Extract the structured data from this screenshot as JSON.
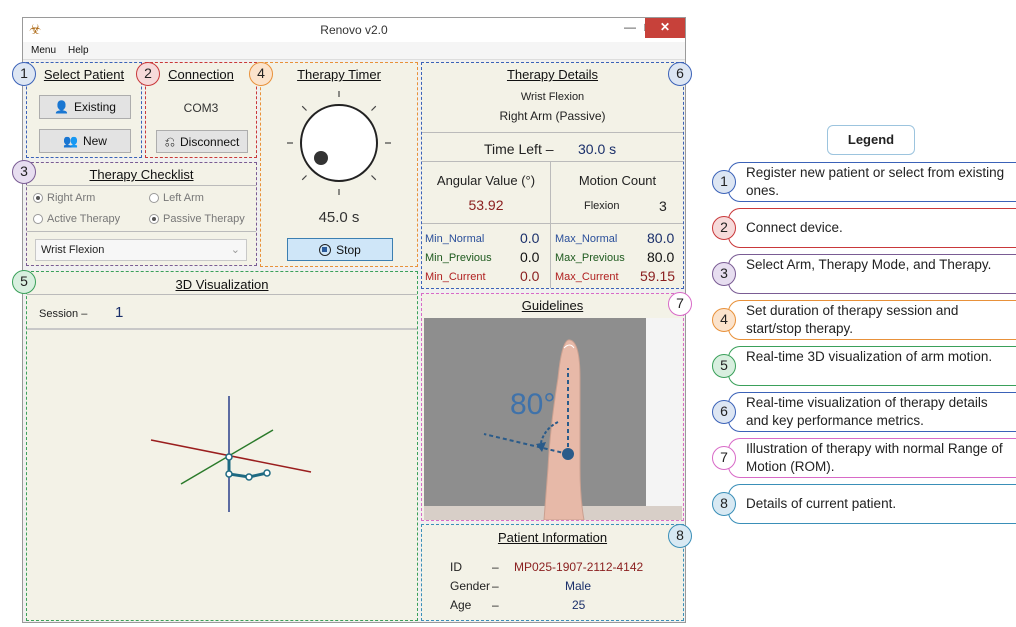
{
  "window": {
    "title": "Renovo v2.0",
    "minimize": "—",
    "maximize": "□",
    "close": "✕",
    "app_icon": "caduceus-icon"
  },
  "menu": {
    "items": [
      "Menu",
      "Help"
    ]
  },
  "select_patient": {
    "title": "Select Patient",
    "existing_label": "Existing",
    "new_label": "New"
  },
  "connection": {
    "title": "Connection",
    "port": "COM3",
    "disconnect_label": "Disconnect"
  },
  "therapy_timer": {
    "title": "Therapy Timer",
    "time": "45.0 s",
    "stop_label": "Stop"
  },
  "therapy_details": {
    "title": "Therapy Details",
    "therapy": "Wrist Flexion",
    "arm_mode": "Right Arm (Passive)",
    "time_left_label": "Time Left –",
    "time_left_value": "30.0 s",
    "angular_header": "Angular Value (°)",
    "angular_value": "53.92",
    "motion_header": "Motion Count",
    "motion_label": "Flexion",
    "motion_value": "3",
    "min_normal_label": "Min_Normal",
    "min_normal_value": "0.0",
    "min_previous_label": "Min_Previous",
    "min_previous_value": "0.0",
    "min_current_label": "Min_Current",
    "min_current_value": "0.0",
    "max_normal_label": "Max_Normal",
    "max_normal_value": "80.0",
    "max_previous_label": "Max_Previous",
    "max_previous_value": "80.0",
    "max_current_label": "Max_Current",
    "max_current_value": "59.15"
  },
  "checklist": {
    "title": "Therapy Checklist",
    "right_arm": "Right Arm",
    "left_arm": "Left Arm",
    "active": "Active Therapy",
    "passive": "Passive Therapy",
    "selected_therapy": "Wrist Flexion"
  },
  "visualization": {
    "title": "3D Visualization",
    "session_label": "Session –",
    "session_value": "1"
  },
  "guidelines": {
    "title": "Guidelines",
    "angle_label": "80°"
  },
  "patient_info": {
    "title": "Patient Information",
    "id_label": "ID",
    "id_dash": "–",
    "id_value": "MP025-1907-2112-4142",
    "gender_label": "Gender",
    "gender_dash": "–",
    "gender_value": "Male",
    "age_label": "Age",
    "age_dash": "–",
    "age_value": "25"
  },
  "badges": [
    "1",
    "2",
    "3",
    "4",
    "5",
    "6",
    "7",
    "8"
  ],
  "legend": {
    "title": "Legend",
    "items": [
      {
        "num": "1",
        "text": "Register new patient or select from existing ones."
      },
      {
        "num": "2",
        "text": "Connect device."
      },
      {
        "num": "3",
        "text": "Select Arm, Therapy Mode, and Therapy."
      },
      {
        "num": "4",
        "text": "Set duration of therapy session and start/stop therapy."
      },
      {
        "num": "5",
        "text": "Real-time 3D visualization of arm motion."
      },
      {
        "num": "6",
        "text": "Real-time visualization of therapy details and key performance metrics."
      },
      {
        "num": "7",
        "text": "Illustration of therapy with normal Range of Motion (ROM)."
      },
      {
        "num": "8",
        "text": "Details of current patient."
      }
    ]
  },
  "colors": {
    "blue": "#3b62b8",
    "red": "#c9383a",
    "orange": "#e8913a",
    "purple": "#7a5c94",
    "green": "#3aa05a",
    "pink": "#d86ac7",
    "teal": "#3a8fb8"
  }
}
